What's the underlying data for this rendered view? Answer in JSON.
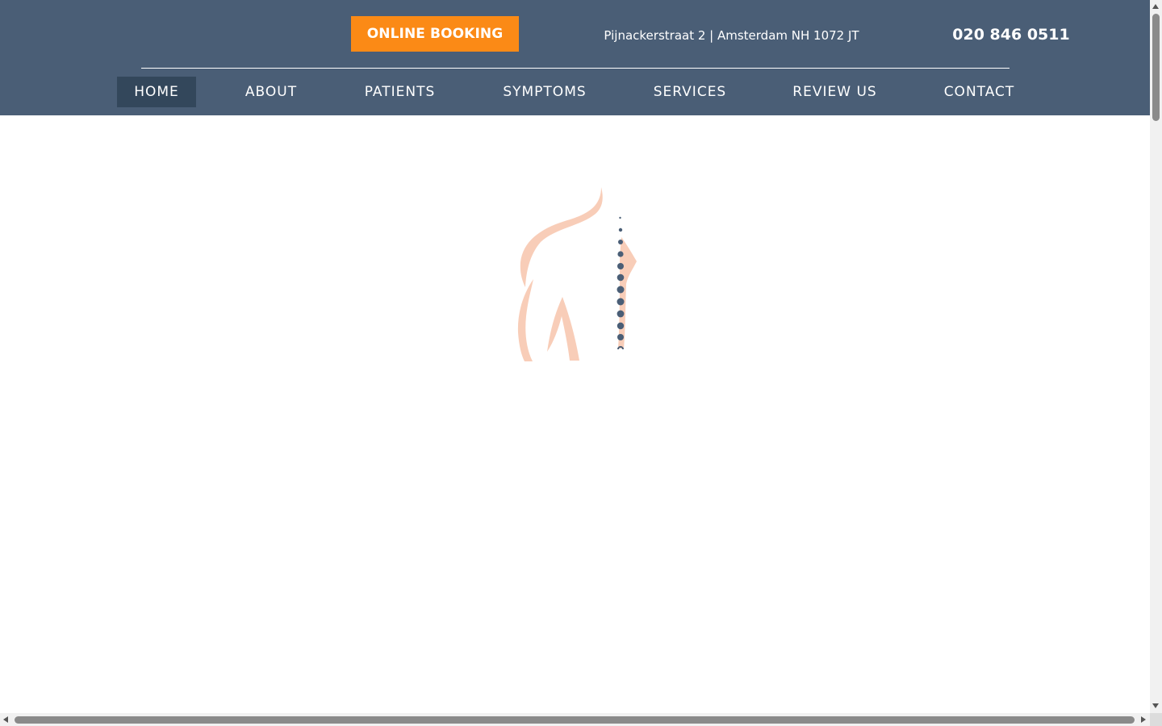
{
  "header": {
    "booking_label": "ONLINE BOOKING",
    "address": "Pijnackerstraat 2 | Amsterdam NH 1072 JT",
    "phone": "020 846 0511"
  },
  "nav": {
    "items": [
      {
        "label": "HOME",
        "active": true
      },
      {
        "label": "ABOUT",
        "active": false
      },
      {
        "label": "PATIENTS",
        "active": false
      },
      {
        "label": "SYMPTOMS",
        "active": false
      },
      {
        "label": "SERVICES",
        "active": false
      },
      {
        "label": "REVIEW US",
        "active": false
      },
      {
        "label": "CONTACT",
        "active": false
      }
    ]
  },
  "loader": {
    "icon": "spine-back-icon"
  },
  "colors": {
    "header_bg": "#4a5e76",
    "nav_active_bg": "#33475b",
    "booking_bg": "#fb8a16",
    "figure_skin": "#f8cdb8",
    "spine_dots": "#4a5e76"
  }
}
